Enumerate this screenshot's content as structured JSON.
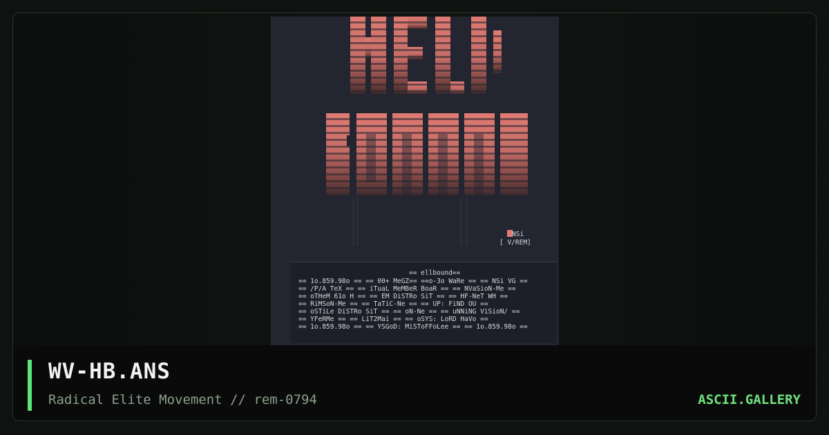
{
  "card": {
    "title": "WV-HB.ANS",
    "subtitle": "Radical Elite Movement // rem-0794",
    "brand": "ASCII.GALLERY"
  },
  "artwork": {
    "heading_lines": [
      "NEL1",
      "EONNN"
    ],
    "tag_line_1": "NSi",
    "tag_line_2": "[  V/REM]",
    "list_lines": [
      "== ellbound==",
      "== 1o.859.98o ==    == 00+ MeGZ==   ==o-3o WaRe ==   == NSi VG ==",
      "== /P/A TeX ==      == iTuaL MeMBeR BoaR ==    == NVaSioN-Me ==",
      "== oTHeM 61o H ==      == EM DiSTRo SiT ==       == HF-NeT WH ==",
      "== RiMSoN-Me ==          == TaTiC-Ne ==        == UP: FiND OU ==",
      "== oSTiLe DiSTRo SiT ==    == oN-Ne ==      == uNNiNG ViSioN/ ==",
      "== YFeRMe ==             == LiT2Mai ==     == oSYS: LoRD HaVo ==",
      "== 1o.859.98o ==    == YSGoD: MiSToFFoLee ==    == 1o.859.98o =="
    ],
    "colors": {
      "background": "#232530",
      "block_top": "#e07b73",
      "block_mid": "#b9655f",
      "block_dark": "#7a4441",
      "accent_green": "#5ee57a"
    }
  }
}
